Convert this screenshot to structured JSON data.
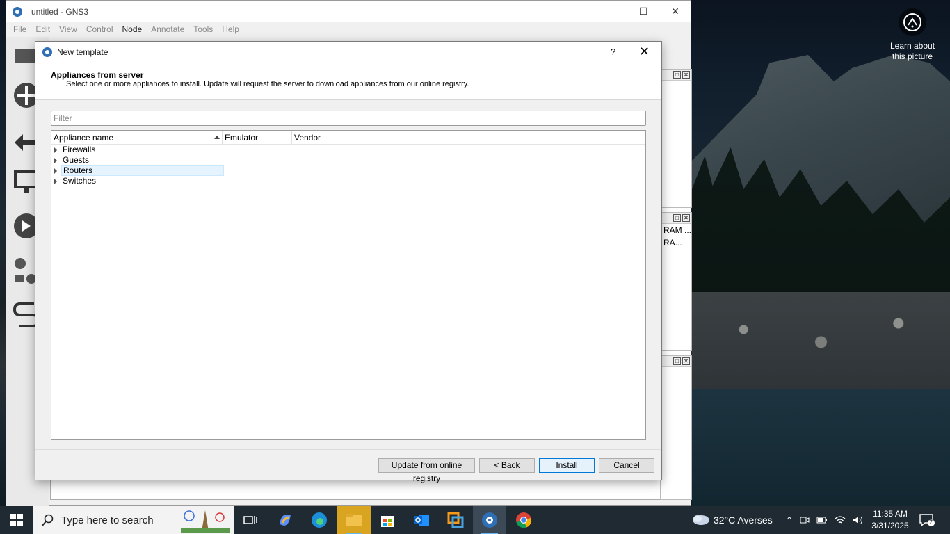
{
  "main_window": {
    "title": "untitled - GNS3",
    "menu": [
      "File",
      "Edit",
      "View",
      "Control",
      "Node",
      "Annotate",
      "Tools",
      "Help"
    ],
    "menu_active": "Node",
    "dock_text": [
      "RAM ...",
      "RA..."
    ]
  },
  "desktop": {
    "learn_label": "Learn about this picture"
  },
  "dialog": {
    "title": "New template",
    "help_glyph": "?",
    "header_title": "Appliances from server",
    "header_subtitle": "Select one or more appliances to install. Update will request the server to download appliances from our online registry.",
    "filter_placeholder": "Filter",
    "filter_value": "",
    "columns": [
      "Appliance name",
      "Emulator",
      "Vendor"
    ],
    "sort_column": "Appliance name",
    "tree_items": [
      "Firewalls",
      "Guests",
      "Routers",
      "Switches"
    ],
    "hovered_item": "Routers",
    "buttons": {
      "update": "Update from online registry",
      "back": "< Back",
      "install": "Install",
      "cancel": "Cancel"
    },
    "default_button": "install"
  },
  "taskbar": {
    "search_placeholder": "Type here to search",
    "weather": "32°C  Averses",
    "time": "11:35 AM",
    "date": "3/31/2025",
    "notification_count": "7",
    "apps": [
      "task-view",
      "copilot",
      "edge",
      "file-explorer",
      "microsoft-store",
      "outlook",
      "vmware",
      "gns3",
      "chrome"
    ],
    "active_app": "gns3"
  },
  "colors": {
    "accent": "#0078d7",
    "taskbar": "#1f2a33",
    "hover_row": "#e5f3ff"
  }
}
